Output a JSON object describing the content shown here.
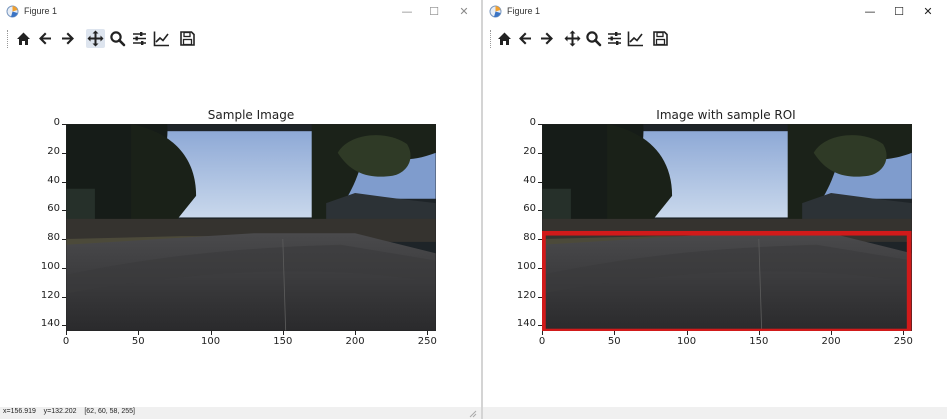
{
  "windows": [
    {
      "title": "Figure 1",
      "minimize": "—",
      "maximize": "☐",
      "close": "✕",
      "axes_title": "Sample Image",
      "show_roi": false,
      "status": "x=156.919    y=132.202    [62, 60, 58, 255]"
    },
    {
      "title": "Figure 1",
      "minimize": "—",
      "maximize": "☐",
      "close": "✕",
      "axes_title": "Image with sample ROI",
      "show_roi": true,
      "status": ""
    }
  ],
  "toolbar": [
    "home-icon",
    "back-icon",
    "forward-icon",
    "pan-icon",
    "zoom-icon",
    "configure-subplots-icon",
    "edit-axis-icon",
    "save-icon"
  ],
  "axes": {
    "xticks": [
      "0",
      "50",
      "100",
      "150",
      "200",
      "250"
    ],
    "yticks": [
      "0",
      "20",
      "40",
      "60",
      "80",
      "100",
      "120",
      "140"
    ]
  },
  "roi": {
    "color": "#d11a1a",
    "x0": 0,
    "x1": 256,
    "y0": 76,
    "y1": 144
  },
  "image": {
    "width": 256,
    "height": 144
  }
}
